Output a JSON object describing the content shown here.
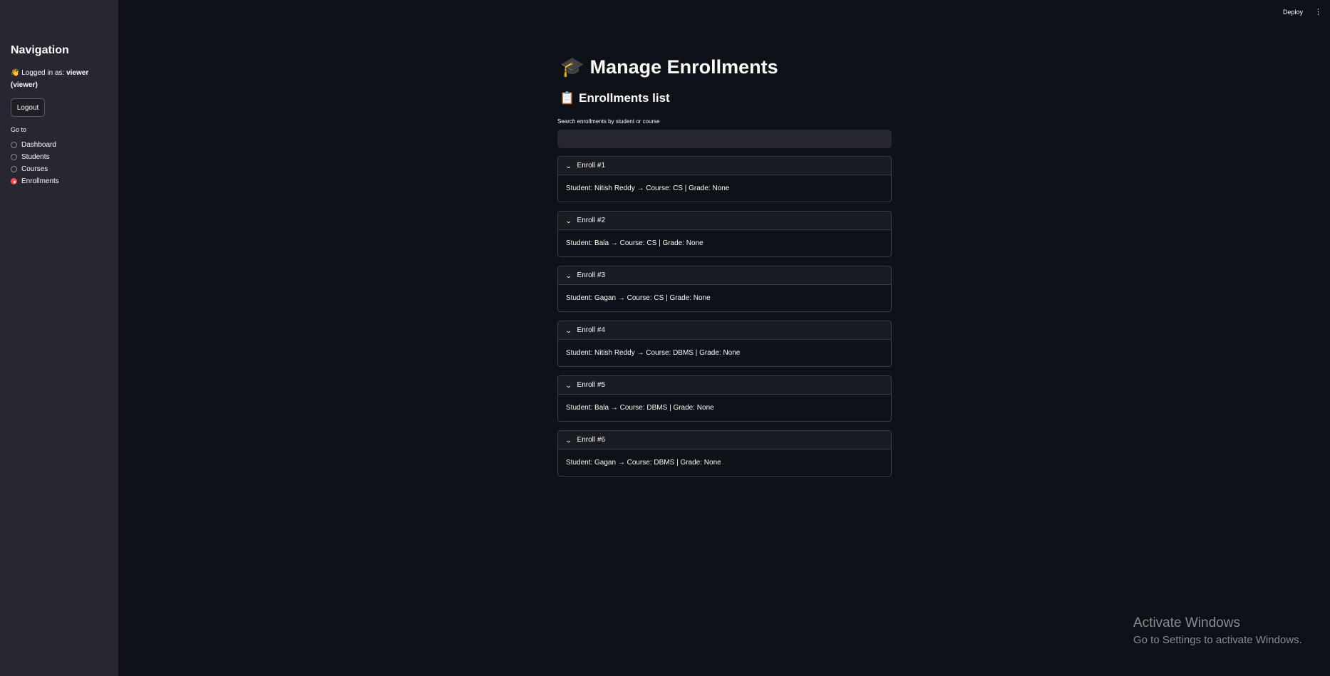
{
  "sidebar": {
    "title": "Navigation",
    "logged_in_prefix": "Logged in as:",
    "logged_in_user": "viewer",
    "logged_in_role": "(viewer)",
    "wave_emoji": "👋",
    "logout_label": "Logout",
    "goto_label": "Go to",
    "nav_items": [
      {
        "label": "Dashboard",
        "selected": false
      },
      {
        "label": "Students",
        "selected": false
      },
      {
        "label": "Courses",
        "selected": false
      },
      {
        "label": "Enrollments",
        "selected": true
      }
    ],
    "accent_color": "#ff4b4b"
  },
  "header": {
    "deploy_label": "Deploy",
    "menu_icon": "kebab-menu-icon"
  },
  "main": {
    "title_emoji": "🎓",
    "title": "Manage Enrollments",
    "section_emoji": "📋",
    "section_title": "Enrollments list",
    "search_label": "Search enrollments by student or course",
    "search_value": "",
    "enrollments": [
      {
        "title": "Enroll #1",
        "detail": "Student: Nitish Reddy → Course: CS | Grade: None"
      },
      {
        "title": "Enroll #2",
        "detail": "Student: Bala → Course: CS | Grade: None"
      },
      {
        "title": "Enroll #3",
        "detail": "Student: Gagan → Course: CS | Grade: None"
      },
      {
        "title": "Enroll #4",
        "detail": "Student: Nitish Reddy → Course: DBMS | Grade: None"
      },
      {
        "title": "Enroll #5",
        "detail": "Student: Bala → Course: DBMS | Grade: None"
      },
      {
        "title": "Enroll #6",
        "detail": "Student: Gagan → Course: DBMS | Grade: None"
      }
    ]
  },
  "watermark": {
    "line1": "Activate Windows",
    "line2": "Go to Settings to activate Windows."
  }
}
